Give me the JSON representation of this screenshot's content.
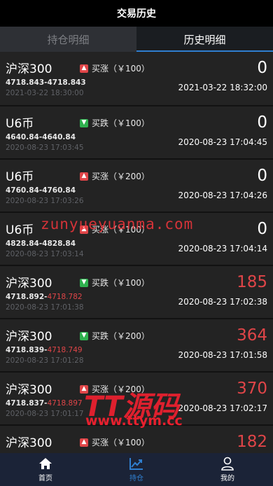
{
  "header": {
    "title": "交易历史"
  },
  "tabs": [
    {
      "label": "持仓明细",
      "active": false
    },
    {
      "label": "历史明细",
      "active": true
    }
  ],
  "trades": [
    {
      "name": "沪深300",
      "direction": "up",
      "direction_label": "买涨（￥100）",
      "open_price": "4718.843",
      "close_price": "4718.843",
      "close_red": false,
      "open_time": "2021-03-22 18:30:00",
      "profit": "0",
      "profit_red": false,
      "close_time": "2021-03-22 18:32:00"
    },
    {
      "name": "U6币",
      "direction": "down",
      "direction_label": "买跌（￥100）",
      "open_price": "4640.84",
      "close_price": "4640.84",
      "close_red": false,
      "open_time": "2020-08-23 17:03:45",
      "profit": "0",
      "profit_red": false,
      "close_time": "2020-08-23 17:04:45"
    },
    {
      "name": "U6币",
      "direction": "up",
      "direction_label": "买涨（￥200）",
      "open_price": "4760.84",
      "close_price": "4760.84",
      "close_red": false,
      "open_time": "2020-08-23 17:03:26",
      "profit": "0",
      "profit_red": false,
      "close_time": "2020-08-23 17:04:26"
    },
    {
      "name": "U6币",
      "direction": "up",
      "direction_label": "买涨（￥100）",
      "open_price": "4828.84",
      "close_price": "4828.84",
      "close_red": false,
      "open_time": "2020-08-23 17:03:14",
      "profit": "0",
      "profit_red": false,
      "close_time": "2020-08-23 17:04:14"
    },
    {
      "name": "沪深300",
      "direction": "down",
      "direction_label": "买跌（￥100）",
      "open_price": "4718.892",
      "close_price": "4718.782",
      "close_red": true,
      "open_time": "2020-08-23 17:01:38",
      "profit": "185",
      "profit_red": true,
      "close_time": "2020-08-23 17:02:38"
    },
    {
      "name": "沪深300",
      "direction": "down",
      "direction_label": "买跌（￥200）",
      "open_price": "4718.839",
      "close_price": "4718.749",
      "close_red": true,
      "open_time": "2020-08-23 17:01:28",
      "profit": "364",
      "profit_red": true,
      "close_time": "2020-08-23 17:01:58"
    },
    {
      "name": "沪深300",
      "direction": "up",
      "direction_label": "买涨（￥200）",
      "open_price": "4718.837",
      "close_price": "4718.897",
      "close_red": true,
      "open_time": "2020-08-23 17:01:17",
      "profit": "370",
      "profit_red": true,
      "close_time": "2020-08-23 17:02:17"
    },
    {
      "name": "沪深300",
      "direction": "up",
      "direction_label": "买涨（￥100）",
      "open_price": "",
      "close_price": "",
      "close_red": false,
      "open_time": "",
      "profit": "182",
      "profit_red": true,
      "close_time": ""
    }
  ],
  "watermarks": {
    "url_text": "zunyueyuanma.com",
    "brand_text": "TT源码",
    "brand_url": "www.ttym.cc"
  },
  "bottom_nav": [
    {
      "label": "首页",
      "icon": "home-icon",
      "active": false
    },
    {
      "label": "持仓",
      "icon": "trend-chart-icon",
      "active": true
    },
    {
      "label": "我的",
      "icon": "user-icon",
      "active": false
    }
  ],
  "colors": {
    "accent": "#2f7fd0",
    "loss_red": "#e04548",
    "gain_green": "#2fb14f",
    "nav_bg": "#1b2337"
  }
}
